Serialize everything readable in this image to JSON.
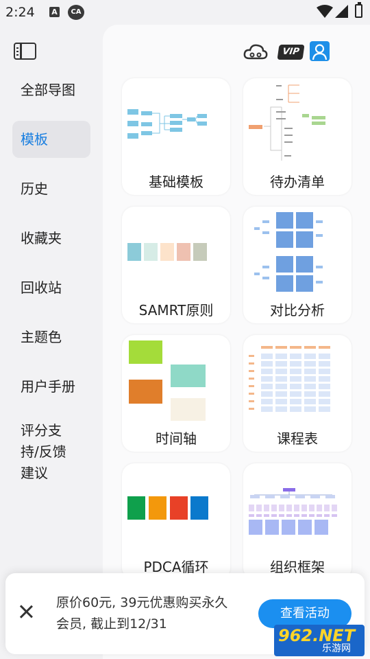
{
  "status_bar": {
    "time": "2:24",
    "notif_a": "A",
    "notif_ca": "CA"
  },
  "sidebar": {
    "items": [
      {
        "label": "全部导图",
        "active": false
      },
      {
        "label": "模板",
        "active": true
      },
      {
        "label": "历史",
        "active": false
      },
      {
        "label": "收藏夹",
        "active": false
      },
      {
        "label": "回收站",
        "active": false
      },
      {
        "label": "主题色",
        "active": false
      },
      {
        "label": "用户手册",
        "active": false
      },
      {
        "label": "评分支\n持/反馈\n建议",
        "active": false
      }
    ]
  },
  "header": {
    "vip_label": "VIP"
  },
  "templates": [
    {
      "label": "基础模板",
      "preview": "mindmap-basic"
    },
    {
      "label": "待办清单",
      "preview": "todo-tree"
    },
    {
      "label": "SAMRT原则",
      "preview": "smart-boxes"
    },
    {
      "label": "对比分析",
      "preview": "compare-grid"
    },
    {
      "label": "时间轴",
      "preview": "timeline-blocks"
    },
    {
      "label": "课程表",
      "preview": "schedule-table"
    },
    {
      "label": "PDCA循环",
      "preview": "pdca-boxes"
    },
    {
      "label": "组织框架",
      "preview": "org-chart"
    }
  ],
  "promo": {
    "text": "原价60元, 39元优惠购买永久会员, 截止到12/31",
    "button": "查看活动"
  },
  "watermark": {
    "line1": "962.NET",
    "line2": "乐游网"
  },
  "colors": {
    "accent": "#1b8ff0",
    "active_text": "#1a7fe0",
    "active_bg": "#e4e4e8",
    "panel_bg": "#fafafb",
    "page_bg": "#f2f2f4"
  }
}
